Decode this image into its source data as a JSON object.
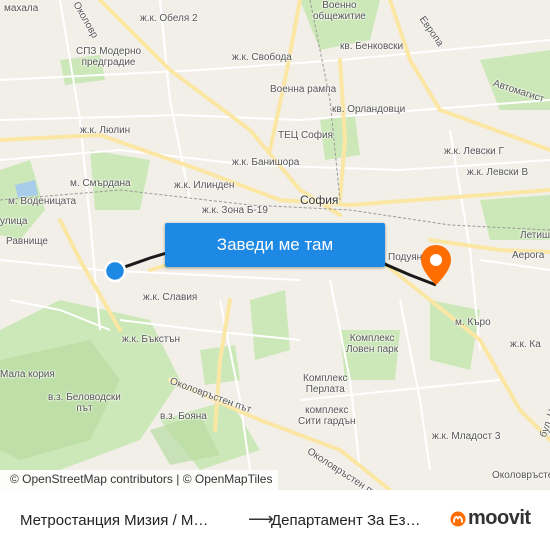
{
  "map": {
    "labels": {
      "mahala": "махала",
      "obelya": "ж.к. Обеля 2",
      "voenno": "Военно\nобщежитие",
      "evropa": "Европа",
      "spz": "СПЗ Модерно\nпредградие",
      "svoboda": "ж.к. Свобода",
      "benkovski": "кв. Бенковски",
      "voenna_rampa": "Военна рампа",
      "avtomagistrala": "Автомагист",
      "orlandovtsi": "кв. Орландовци",
      "lyulin": "ж.к. Люлин",
      "tets": "ТЕЦ София",
      "levski_g": "ж.к. Левски Г",
      "banishora": "ж.к. Банишора",
      "levski_v": "ж.к. Левски В",
      "smyrdana": "м. Смърдана",
      "ilinden": "ж.к. Илинден",
      "vodenitsata": "м. Воденицата",
      "zona_b19": "ж.к. Зона Б-19",
      "sofia": "София",
      "ulitsa": "улица",
      "letishte": "Летиш",
      "ravnishte": "Равнище",
      "poduyane": "Подуяне",
      "aerogara": "Аерога",
      "slaviya": "ж.к. Славия",
      "m_karo": "м. Къро",
      "bakston": "ж.к. Бъкстън",
      "loven_park": "Комплекс\nЛовен парк",
      "zk_ka": "ж.к. Ка",
      "mala_koriya": "Мала кория",
      "perlata": "Комплекс\nПерлата",
      "belovodski": "в.з. Беловодски\nпът",
      "boyana": "в.з. Бояна",
      "okolovrasten": "Околовръстен път",
      "siti_garden": "комплекс\nСити гардън",
      "tsarigr": "бул. Цари",
      "mladost3": "ж.к. Младост 3",
      "okolovrasten2": "Околовръстен път",
      "okolovrasten3": "Околовр",
      "okolovrasten4": "Околовръстен п"
    },
    "attribution": "© OpenStreetMap contributors | © OpenMapTiles",
    "colors": {
      "park": "#c9e6b4",
      "road": "#ffffff",
      "major_road": "#f7e6a1",
      "origin": "#1e88e5",
      "destination": "#ff6d00"
    }
  },
  "cta": {
    "label": "Заведи ме там"
  },
  "route": {
    "from": "Метростанция Мизия / М…",
    "to": "Департамент За Ез…"
  },
  "brand": {
    "name": "moovit"
  }
}
